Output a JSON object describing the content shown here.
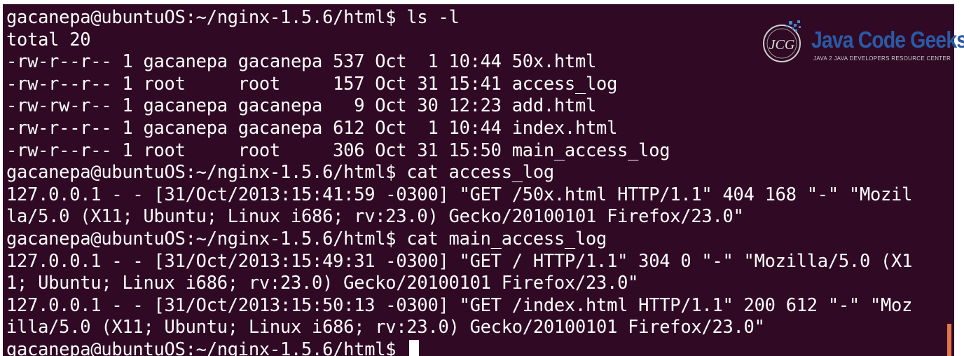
{
  "terminal": {
    "lines": [
      "gacanepa@ubuntuOS:~/nginx-1.5.6/html$ ls -l",
      "total 20",
      "-rw-r--r-- 1 gacanepa gacanepa 537 Oct  1 10:44 50x.html",
      "-rw-r--r-- 1 root     root     157 Oct 31 15:41 access_log",
      "-rw-rw-r-- 1 gacanepa gacanepa   9 Oct 30 12:23 add.html",
      "-rw-r--r-- 1 gacanepa gacanepa 612 Oct  1 10:44 index.html",
      "-rw-r--r-- 1 root     root     306 Oct 31 15:50 main_access_log",
      "gacanepa@ubuntuOS:~/nginx-1.5.6/html$ cat access_log",
      "127.0.0.1 - - [31/Oct/2013:15:41:59 -0300] \"GET /50x.html HTTP/1.1\" 404 168 \"-\" \"Mozil",
      "la/5.0 (X11; Ubuntu; Linux i686; rv:23.0) Gecko/20100101 Firefox/23.0\"",
      "gacanepa@ubuntuOS:~/nginx-1.5.6/html$ cat main_access_log",
      "127.0.0.1 - - [31/Oct/2013:15:49:31 -0300] \"GET / HTTP/1.1\" 304 0 \"-\" \"Mozilla/5.0 (X1",
      "1; Ubuntu; Linux i686; rv:23.0) Gecko/20100101 Firefox/23.0\"",
      "127.0.0.1 - - [31/Oct/2013:15:50:13 -0300] \"GET /index.html HTTP/1.1\" 200 612 \"-\" \"Moz",
      "illa/5.0 (X11; Ubuntu; Linux i686; rv:23.0) Gecko/20100101 Firefox/23.0\""
    ],
    "prompt": "gacanepa@ubuntuOS:~/nginx-1.5.6/html$",
    "colors": {
      "background": "#300a24",
      "text": "#ffffff",
      "accent": "#e2764a"
    }
  },
  "logo": {
    "initials": "JCG",
    "title": "Java Code Geeks",
    "subtitle": "JAVA 2 JAVA DEVELOPERS RESOURCE CENTER",
    "color": "#2a5aa5"
  }
}
